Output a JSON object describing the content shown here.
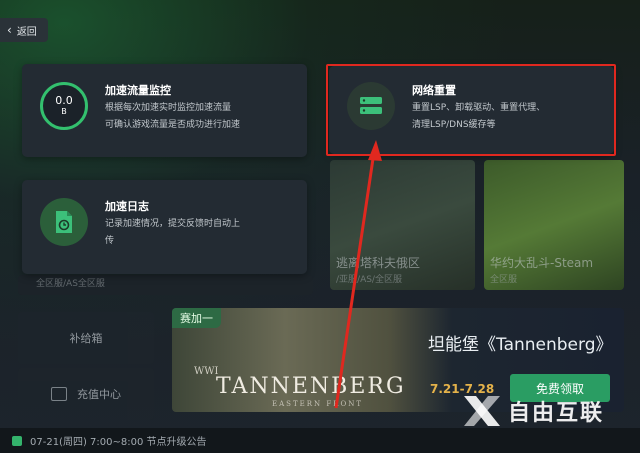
{
  "back_button": {
    "label": "返回"
  },
  "cards": {
    "traffic": {
      "title": "加速流量监控",
      "desc_line1": "根据每次加速实时监控加速流量",
      "desc_line2": "可确认游戏流量是否成功进行加速",
      "gauge_value": "0.0",
      "gauge_unit": "B"
    },
    "network_reset": {
      "title": "网络重置",
      "desc_line1": "重置LSP、卸载驱动、重置代理、",
      "desc_line2": "清理LSP/DNS缓存等"
    },
    "log": {
      "title": "加速日志",
      "desc_line1": "记录加速情况，提交反馈时自动上",
      "desc_line2": "传"
    }
  },
  "background": {
    "tile_a_title": "逃离塔科夫俄区",
    "tile_a_sub": "/亚服/AS/全区服",
    "tile_b_title": "华约大乱斗-Steam",
    "tile_b_sub": "全区服",
    "left_sub": "全区服/AS全区服",
    "side_item_1": "补给箱",
    "side_item_2": "充值中心"
  },
  "banner": {
    "tag": "赛加一",
    "wwi": "WWI",
    "logo": "TANNENBERG",
    "logo_sub": "EASTERN FRONT",
    "title": "坦能堡《Tannenberg》",
    "date": "7.21-7.28",
    "claim_button": "免费领取"
  },
  "status_bar": {
    "text": "07-21(周四) 7:00~8:00 节点升级公告"
  },
  "watermark": {
    "text": "自由互联"
  },
  "colors": {
    "accent_green": "#33c06e",
    "highlight_red": "#e0281f",
    "card_bg": "#232b33"
  }
}
